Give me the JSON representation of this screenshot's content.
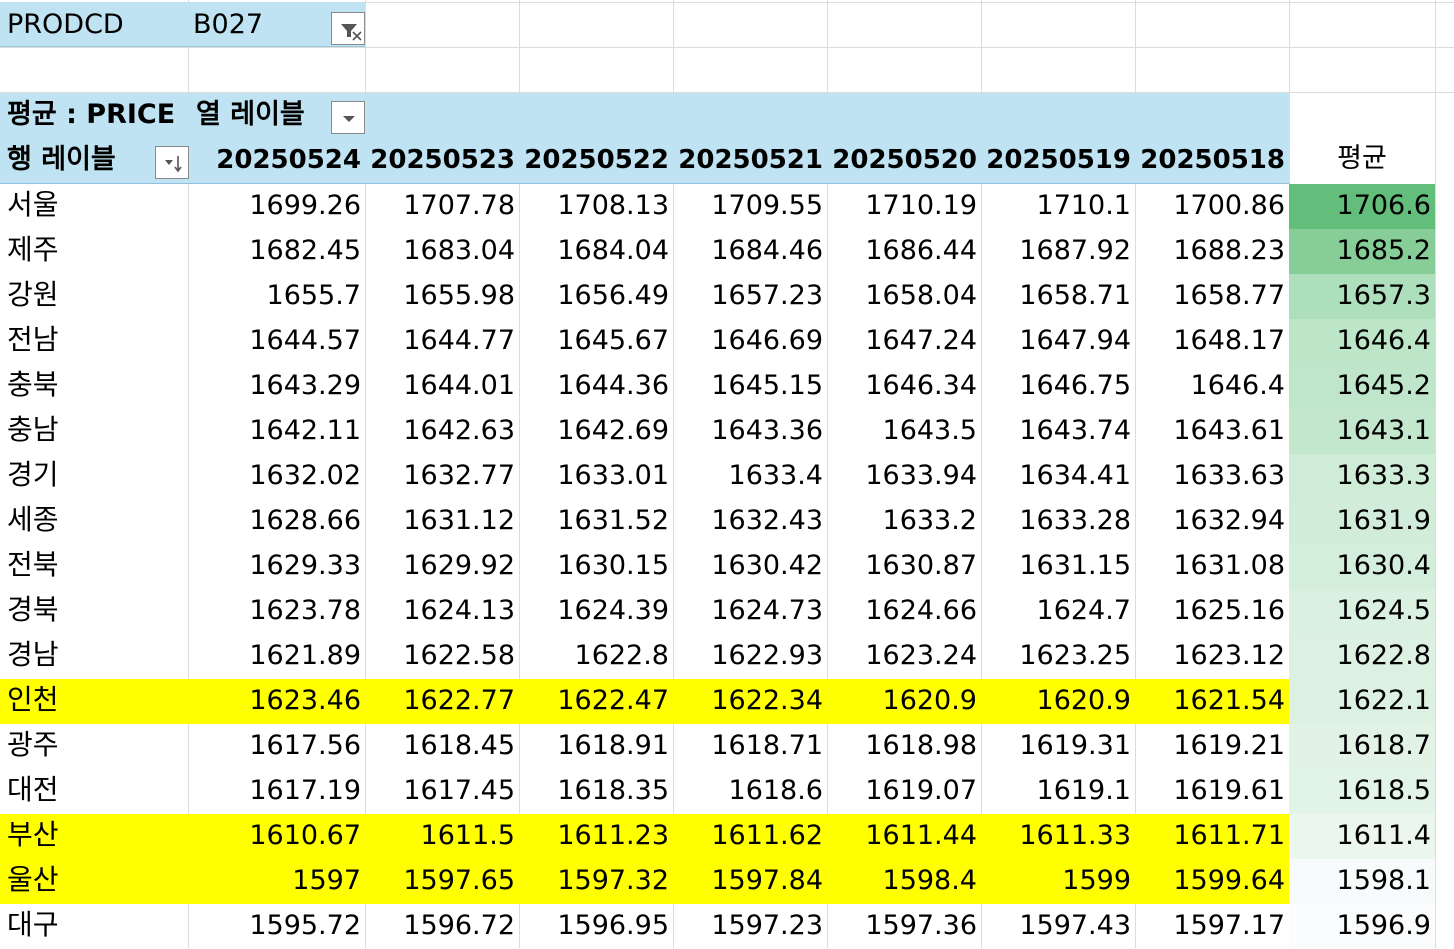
{
  "filter": {
    "field": "PRODCD",
    "value": "B027",
    "icon": "filter-dropdown-icon"
  },
  "pivot": {
    "value_label": "평균 : PRICE",
    "column_labels": "열 레이블",
    "row_labels": "행 레이블",
    "grand_label": "평균",
    "dates": [
      "20250524",
      "20250523",
      "20250522",
      "20250521",
      "20250520",
      "20250519",
      "20250518"
    ],
    "rows": [
      {
        "region": "서울",
        "values": [
          "1699.26",
          "1707.78",
          "1708.13",
          "1709.55",
          "1710.19",
          "1710.1",
          "1700.86"
        ],
        "avg": "1706.6",
        "highlight": false,
        "avg_color": "#63be7b"
      },
      {
        "region": "제주",
        "values": [
          "1682.45",
          "1683.04",
          "1684.04",
          "1684.46",
          "1686.44",
          "1687.92",
          "1688.23"
        ],
        "avg": "1685.2",
        "highlight": false,
        "avg_color": "#86cd98"
      },
      {
        "region": "강원",
        "values": [
          "1655.7",
          "1655.98",
          "1656.49",
          "1657.23",
          "1658.04",
          "1658.71",
          "1658.77"
        ],
        "avg": "1657.3",
        "highlight": false,
        "avg_color": "#aedfbc"
      },
      {
        "region": "전남",
        "values": [
          "1644.57",
          "1644.77",
          "1645.67",
          "1646.69",
          "1647.24",
          "1647.94",
          "1648.17"
        ],
        "avg": "1646.4",
        "highlight": false,
        "avg_color": "#bde5c8"
      },
      {
        "region": "충북",
        "values": [
          "1643.29",
          "1644.01",
          "1644.36",
          "1645.15",
          "1646.34",
          "1646.75",
          "1646.4"
        ],
        "avg": "1645.2",
        "highlight": false,
        "avg_color": "#bfe6ca"
      },
      {
        "region": "충남",
        "values": [
          "1642.11",
          "1642.63",
          "1642.69",
          "1643.36",
          "1643.5",
          "1643.74",
          "1643.61"
        ],
        "avg": "1643.1",
        "highlight": false,
        "avg_color": "#c2e7cc"
      },
      {
        "region": "경기",
        "values": [
          "1632.02",
          "1632.77",
          "1633.01",
          "1633.4",
          "1633.94",
          "1634.41",
          "1633.63"
        ],
        "avg": "1633.3",
        "highlight": false,
        "avg_color": "#cfecd7"
      },
      {
        "region": "세종",
        "values": [
          "1628.66",
          "1631.12",
          "1631.52",
          "1632.43",
          "1633.2",
          "1633.28",
          "1632.94"
        ],
        "avg": "1631.9",
        "highlight": false,
        "avg_color": "#d1edd9"
      },
      {
        "region": "전북",
        "values": [
          "1629.33",
          "1629.92",
          "1630.15",
          "1630.42",
          "1630.87",
          "1631.15",
          "1631.08"
        ],
        "avg": "1630.4",
        "highlight": false,
        "avg_color": "#d3eeda"
      },
      {
        "region": "경북",
        "values": [
          "1623.78",
          "1624.13",
          "1624.39",
          "1624.73",
          "1624.66",
          "1624.7",
          "1625.16"
        ],
        "avg": "1624.5",
        "highlight": false,
        "avg_color": "#daf0e0"
      },
      {
        "region": "경남",
        "values": [
          "1621.89",
          "1622.58",
          "1622.8",
          "1622.93",
          "1623.24",
          "1623.25",
          "1623.12"
        ],
        "avg": "1622.8",
        "highlight": false,
        "avg_color": "#ddf1e2"
      },
      {
        "region": "인천",
        "values": [
          "1623.46",
          "1622.77",
          "1622.47",
          "1622.34",
          "1620.9",
          "1620.9",
          "1621.54"
        ],
        "avg": "1622.1",
        "highlight": true,
        "avg_color": "#ddf1e3"
      },
      {
        "region": "광주",
        "values": [
          "1617.56",
          "1618.45",
          "1618.91",
          "1618.71",
          "1618.98",
          "1619.31",
          "1619.21"
        ],
        "avg": "1618.7",
        "highlight": false,
        "avg_color": "#e2f3e6"
      },
      {
        "region": "대전",
        "values": [
          "1617.19",
          "1617.45",
          "1618.35",
          "1618.6",
          "1619.07",
          "1619.1",
          "1619.61"
        ],
        "avg": "1618.5",
        "highlight": false,
        "avg_color": "#e2f3e7"
      },
      {
        "region": "부산",
        "values": [
          "1610.67",
          "1611.5",
          "1611.23",
          "1611.62",
          "1611.44",
          "1611.33",
          "1611.71"
        ],
        "avg": "1611.4",
        "highlight": true,
        "avg_color": "#eaf6ee"
      },
      {
        "region": "울산",
        "values": [
          "1597",
          "1597.65",
          "1597.32",
          "1597.84",
          "1598.4",
          "1599",
          "1599.64"
        ],
        "avg": "1598.1",
        "highlight": true,
        "avg_color": "#f8fbfc"
      },
      {
        "region": "대구",
        "values": [
          "1595.72",
          "1596.72",
          "1596.95",
          "1597.23",
          "1597.36",
          "1597.43",
          "1597.17"
        ],
        "avg": "1596.9",
        "highlight": false,
        "avg_color": "#fafcfe"
      }
    ]
  },
  "colors": {
    "header_fill": "#bfe3f2",
    "highlight": "#ffff00",
    "grid": "#dcdcdc"
  }
}
